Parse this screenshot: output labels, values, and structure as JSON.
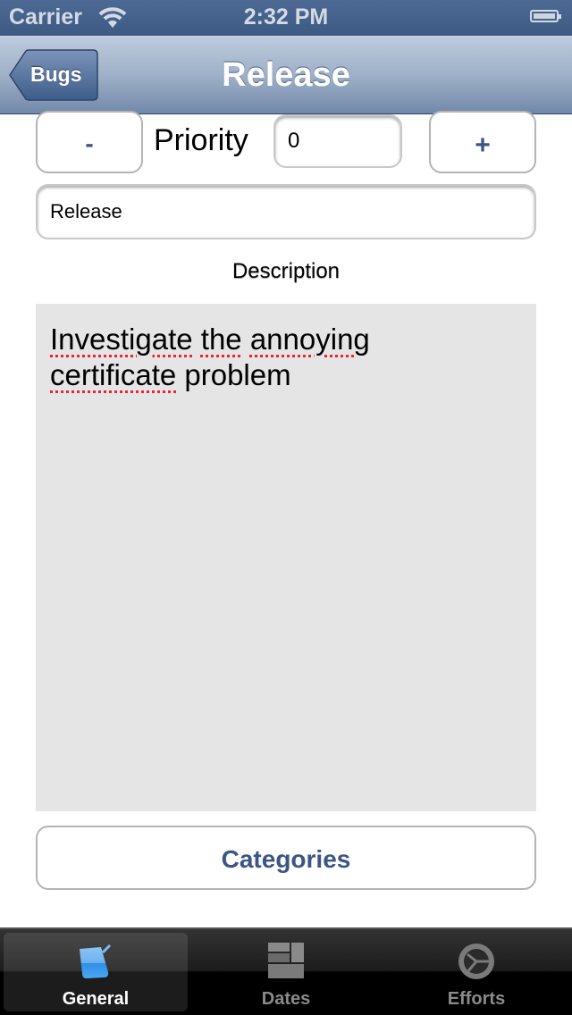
{
  "status_bar": {
    "carrier": "Carrier",
    "time": "2:32 PM",
    "wifi_icon": "wifi-icon",
    "battery_icon": "battery-icon"
  },
  "nav_bar": {
    "title": "Release",
    "back_label": "Bugs"
  },
  "form": {
    "decrement_label": "-",
    "increment_label": "+",
    "priority_label": "Priority",
    "priority_value": "0",
    "title_value": "Release",
    "description_label": "Description",
    "description_words": [
      "Investigate",
      "the",
      "annoying"
    ],
    "description_line2_word": "certificate",
    "description_line2_rest": " problem",
    "description_value": "Investigate the annoying certificate problem",
    "categories_label": "Categories"
  },
  "colors": {
    "accent": "#3b5684",
    "navbar": "#7188a9",
    "text_area_bg": "#e5e5e5"
  },
  "tab_bar": {
    "tabs": [
      {
        "label": "General",
        "icon": "notepad-icon",
        "active": true
      },
      {
        "label": "Dates",
        "icon": "calendar-grid-icon",
        "active": false
      },
      {
        "label": "Efforts",
        "icon": "clock-icon",
        "active": false
      }
    ]
  }
}
